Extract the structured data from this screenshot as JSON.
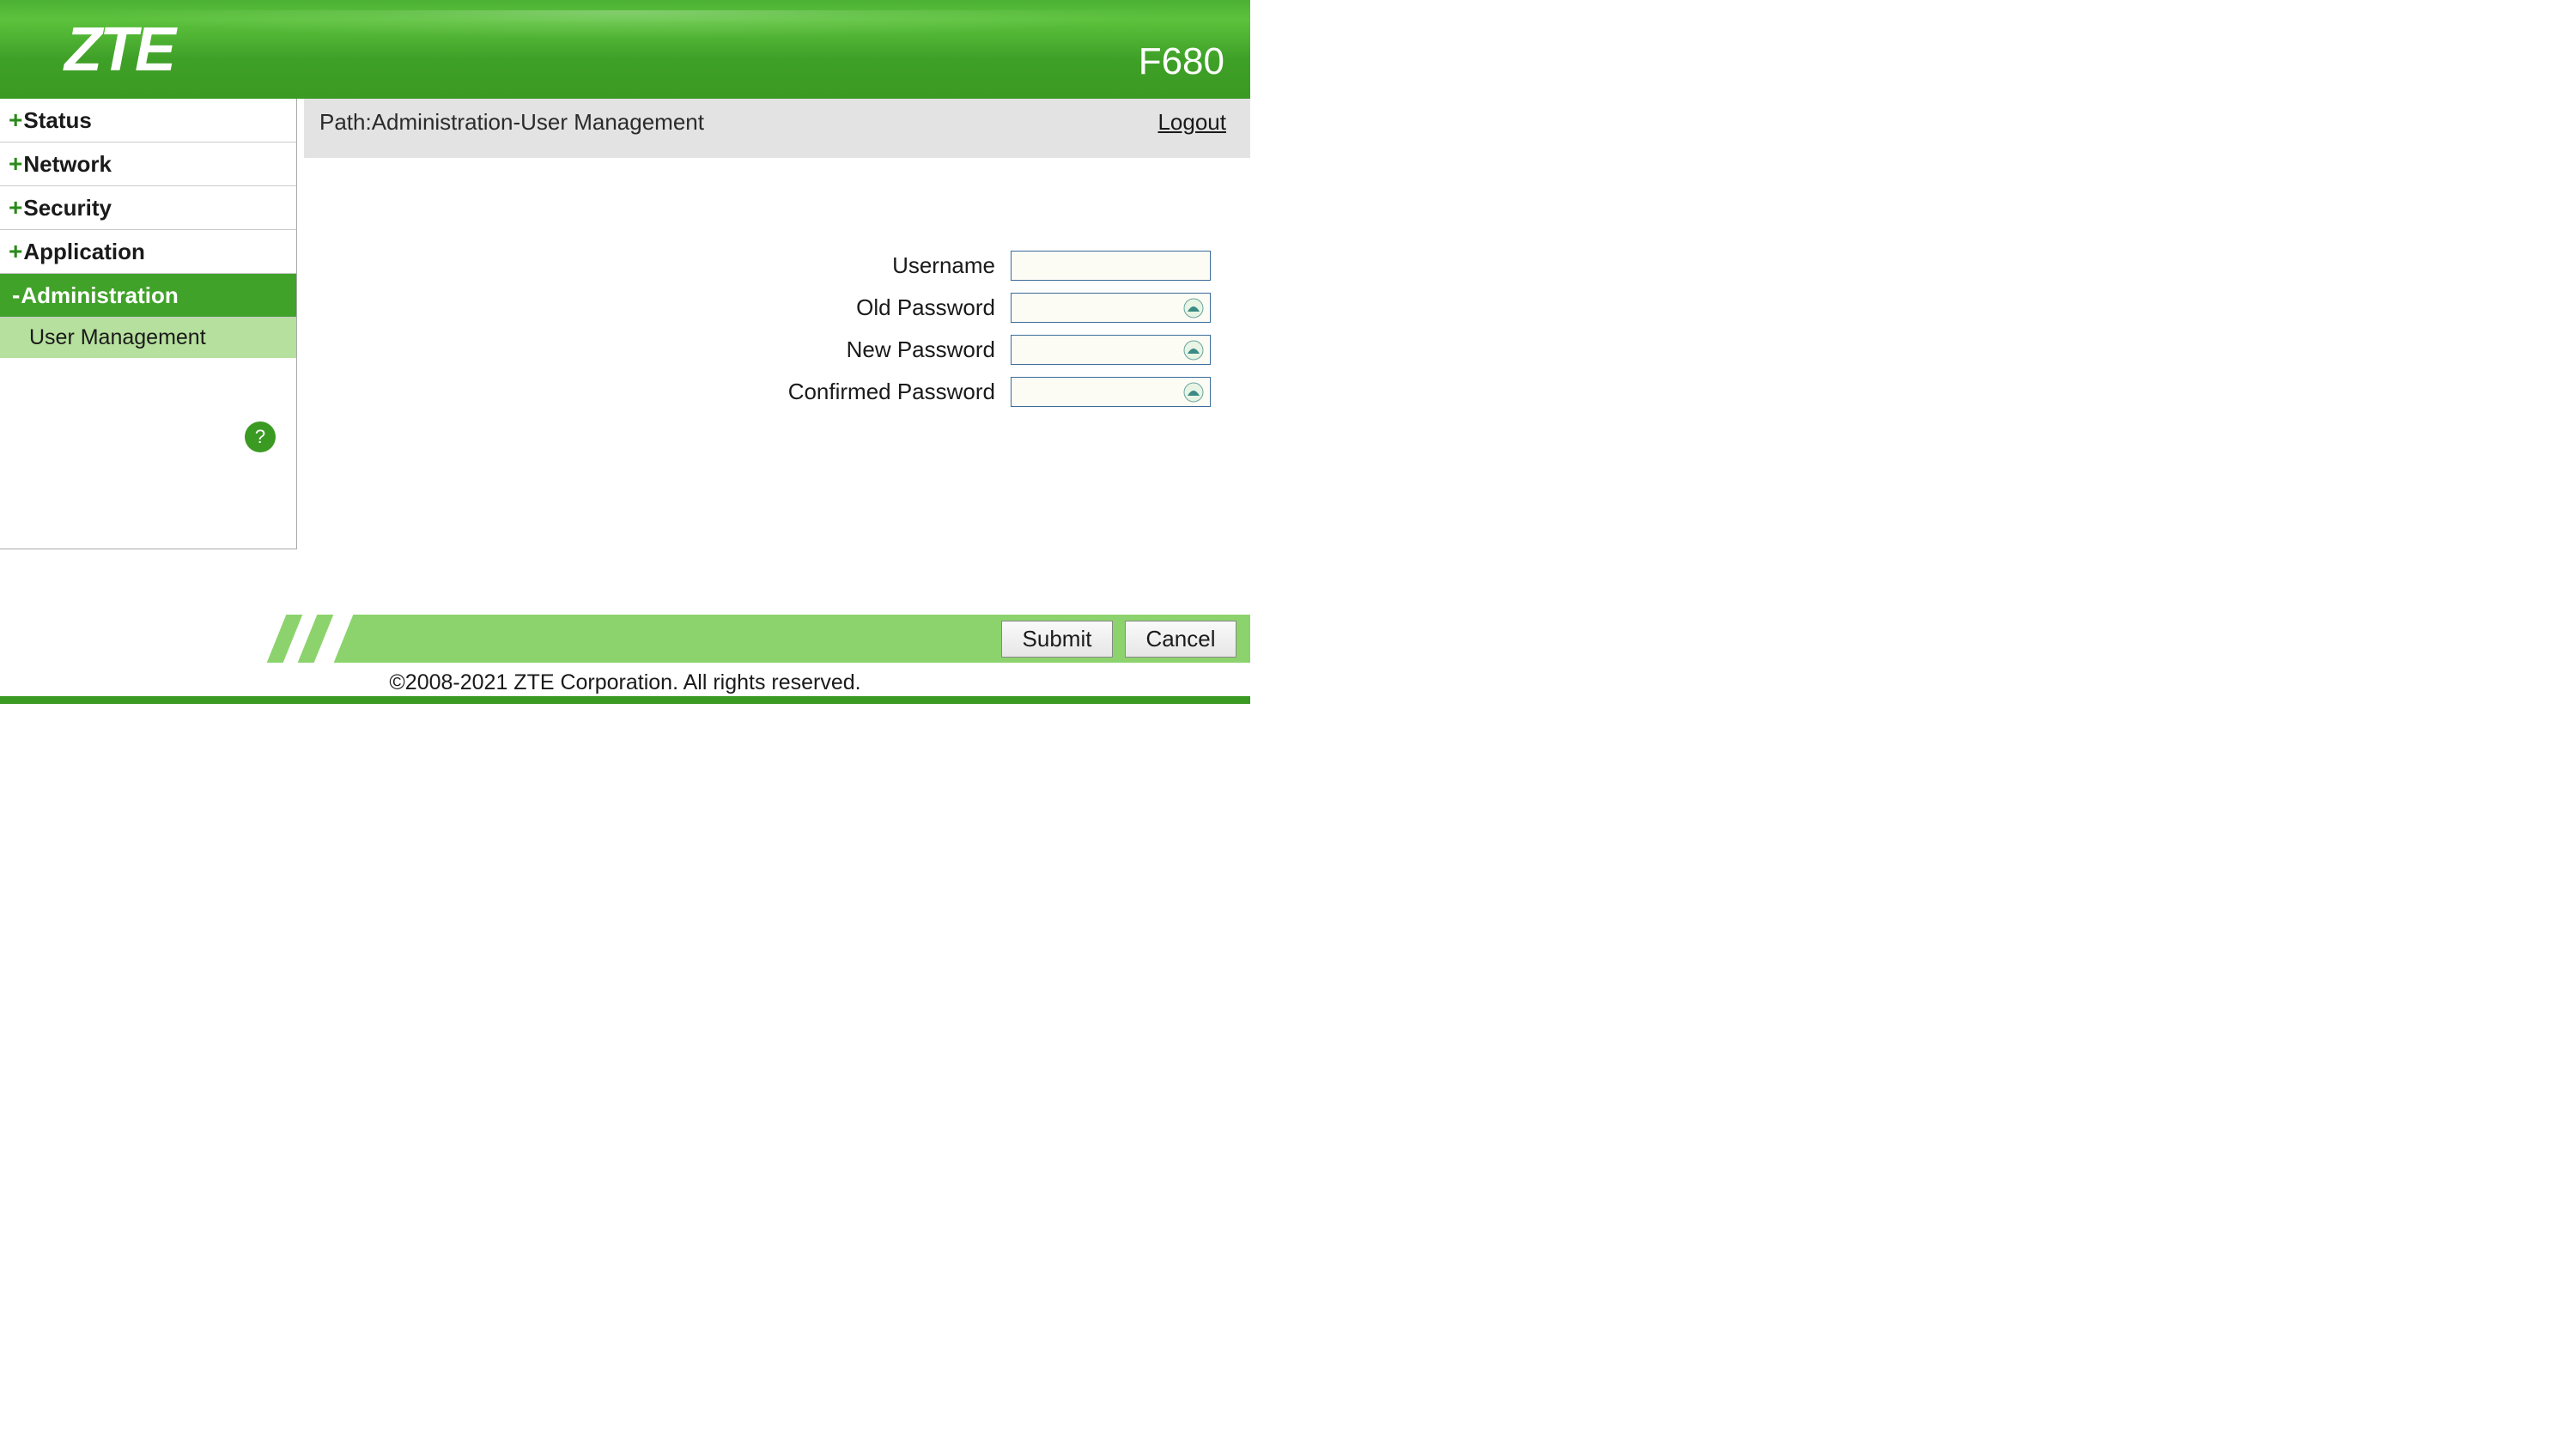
{
  "header": {
    "logo": "ZTE",
    "model": "F680"
  },
  "sidebar": {
    "items": [
      {
        "label": "Status",
        "expandable": true,
        "expanded": false
      },
      {
        "label": "Network",
        "expandable": true,
        "expanded": false
      },
      {
        "label": "Security",
        "expandable": true,
        "expanded": false
      },
      {
        "label": "Application",
        "expandable": true,
        "expanded": false
      },
      {
        "label": "Administration",
        "expandable": true,
        "expanded": true,
        "active": true
      }
    ],
    "subitems": [
      {
        "label": "User Management"
      }
    ],
    "help": "?"
  },
  "pathbar": {
    "path": "Path:Administration-User Management",
    "logout": "Logout"
  },
  "form": {
    "username_label": "Username",
    "old_password_label": "Old Password",
    "new_password_label": "New Password",
    "confirmed_password_label": "Confirmed Password",
    "username_value": "",
    "old_password_value": "",
    "new_password_value": "",
    "confirmed_password_value": ""
  },
  "footer": {
    "submit": "Submit",
    "cancel": "Cancel",
    "copyright": "©2008-2021 ZTE Corporation. All rights reserved."
  }
}
